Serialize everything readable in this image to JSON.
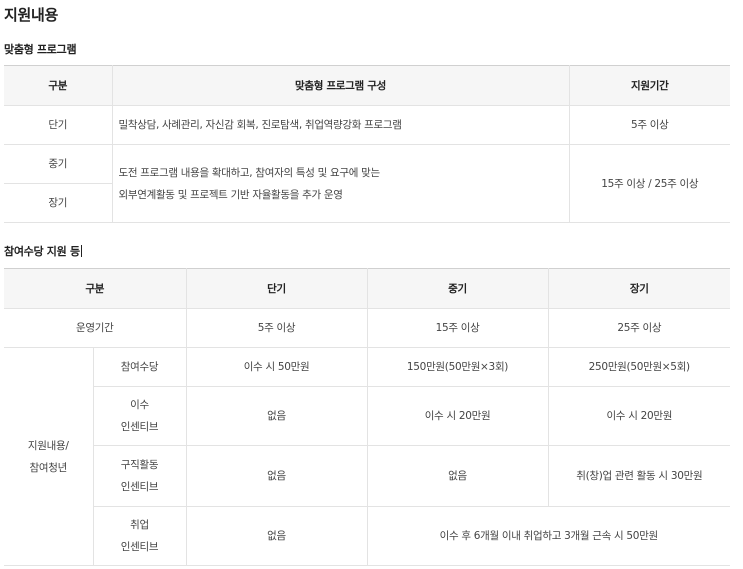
{
  "page_title": "지원내용",
  "section1": {
    "title": "맞춤형 프로그램",
    "headers": [
      "구분",
      "맞춤형 프로그램 구성",
      "지원기간"
    ],
    "rows": {
      "short": {
        "label": "단기",
        "content": "밀착상담, 사례관리, 자신감 회복, 진로탐색, 취업역량강화 프로그램",
        "period": "5주 이상"
      },
      "mid_label": "중기",
      "long_label": "장기",
      "midlong_content_line1": "도전 프로그램 내용을 확대하고, 참여자의 특성 및 요구에 맞는",
      "midlong_content_line2": "외부연계활동 및 프로젝트 기반 자율활동을 추가 운영",
      "midlong_period": "15주 이상 / 25주 이상"
    }
  },
  "section2": {
    "title": "참여수당 지원 등",
    "headers": [
      "구분",
      "단기",
      "중기",
      "장기"
    ],
    "operation": {
      "label": "운영기간",
      "short": "5주 이상",
      "mid": "15주 이상",
      "long": "25주 이상"
    },
    "group_label_line1": "지원내용/",
    "group_label_line2": "참여청년",
    "rows": [
      {
        "label_line1": "참여수당",
        "label_line2": "",
        "short": "이수 시 50만원",
        "mid": "150만원(50만원×3회)",
        "long": "250만원(50만원×5회)"
      },
      {
        "label_line1": "이수",
        "label_line2": "인센티브",
        "short": "없음",
        "mid": "이수 시 20만원",
        "long": "이수 시 20만원"
      },
      {
        "label_line1": "구직활동",
        "label_line2": "인센티브",
        "short": "없음",
        "mid": "없음",
        "long": "취(창)업 관련 활동 시 30만원"
      },
      {
        "label_line1": "취업",
        "label_line2": "인센티브",
        "short": "없음",
        "midlong": "이수 후 6개월 이내 취업하고 3개월 근속 시 50만원"
      }
    ]
  }
}
